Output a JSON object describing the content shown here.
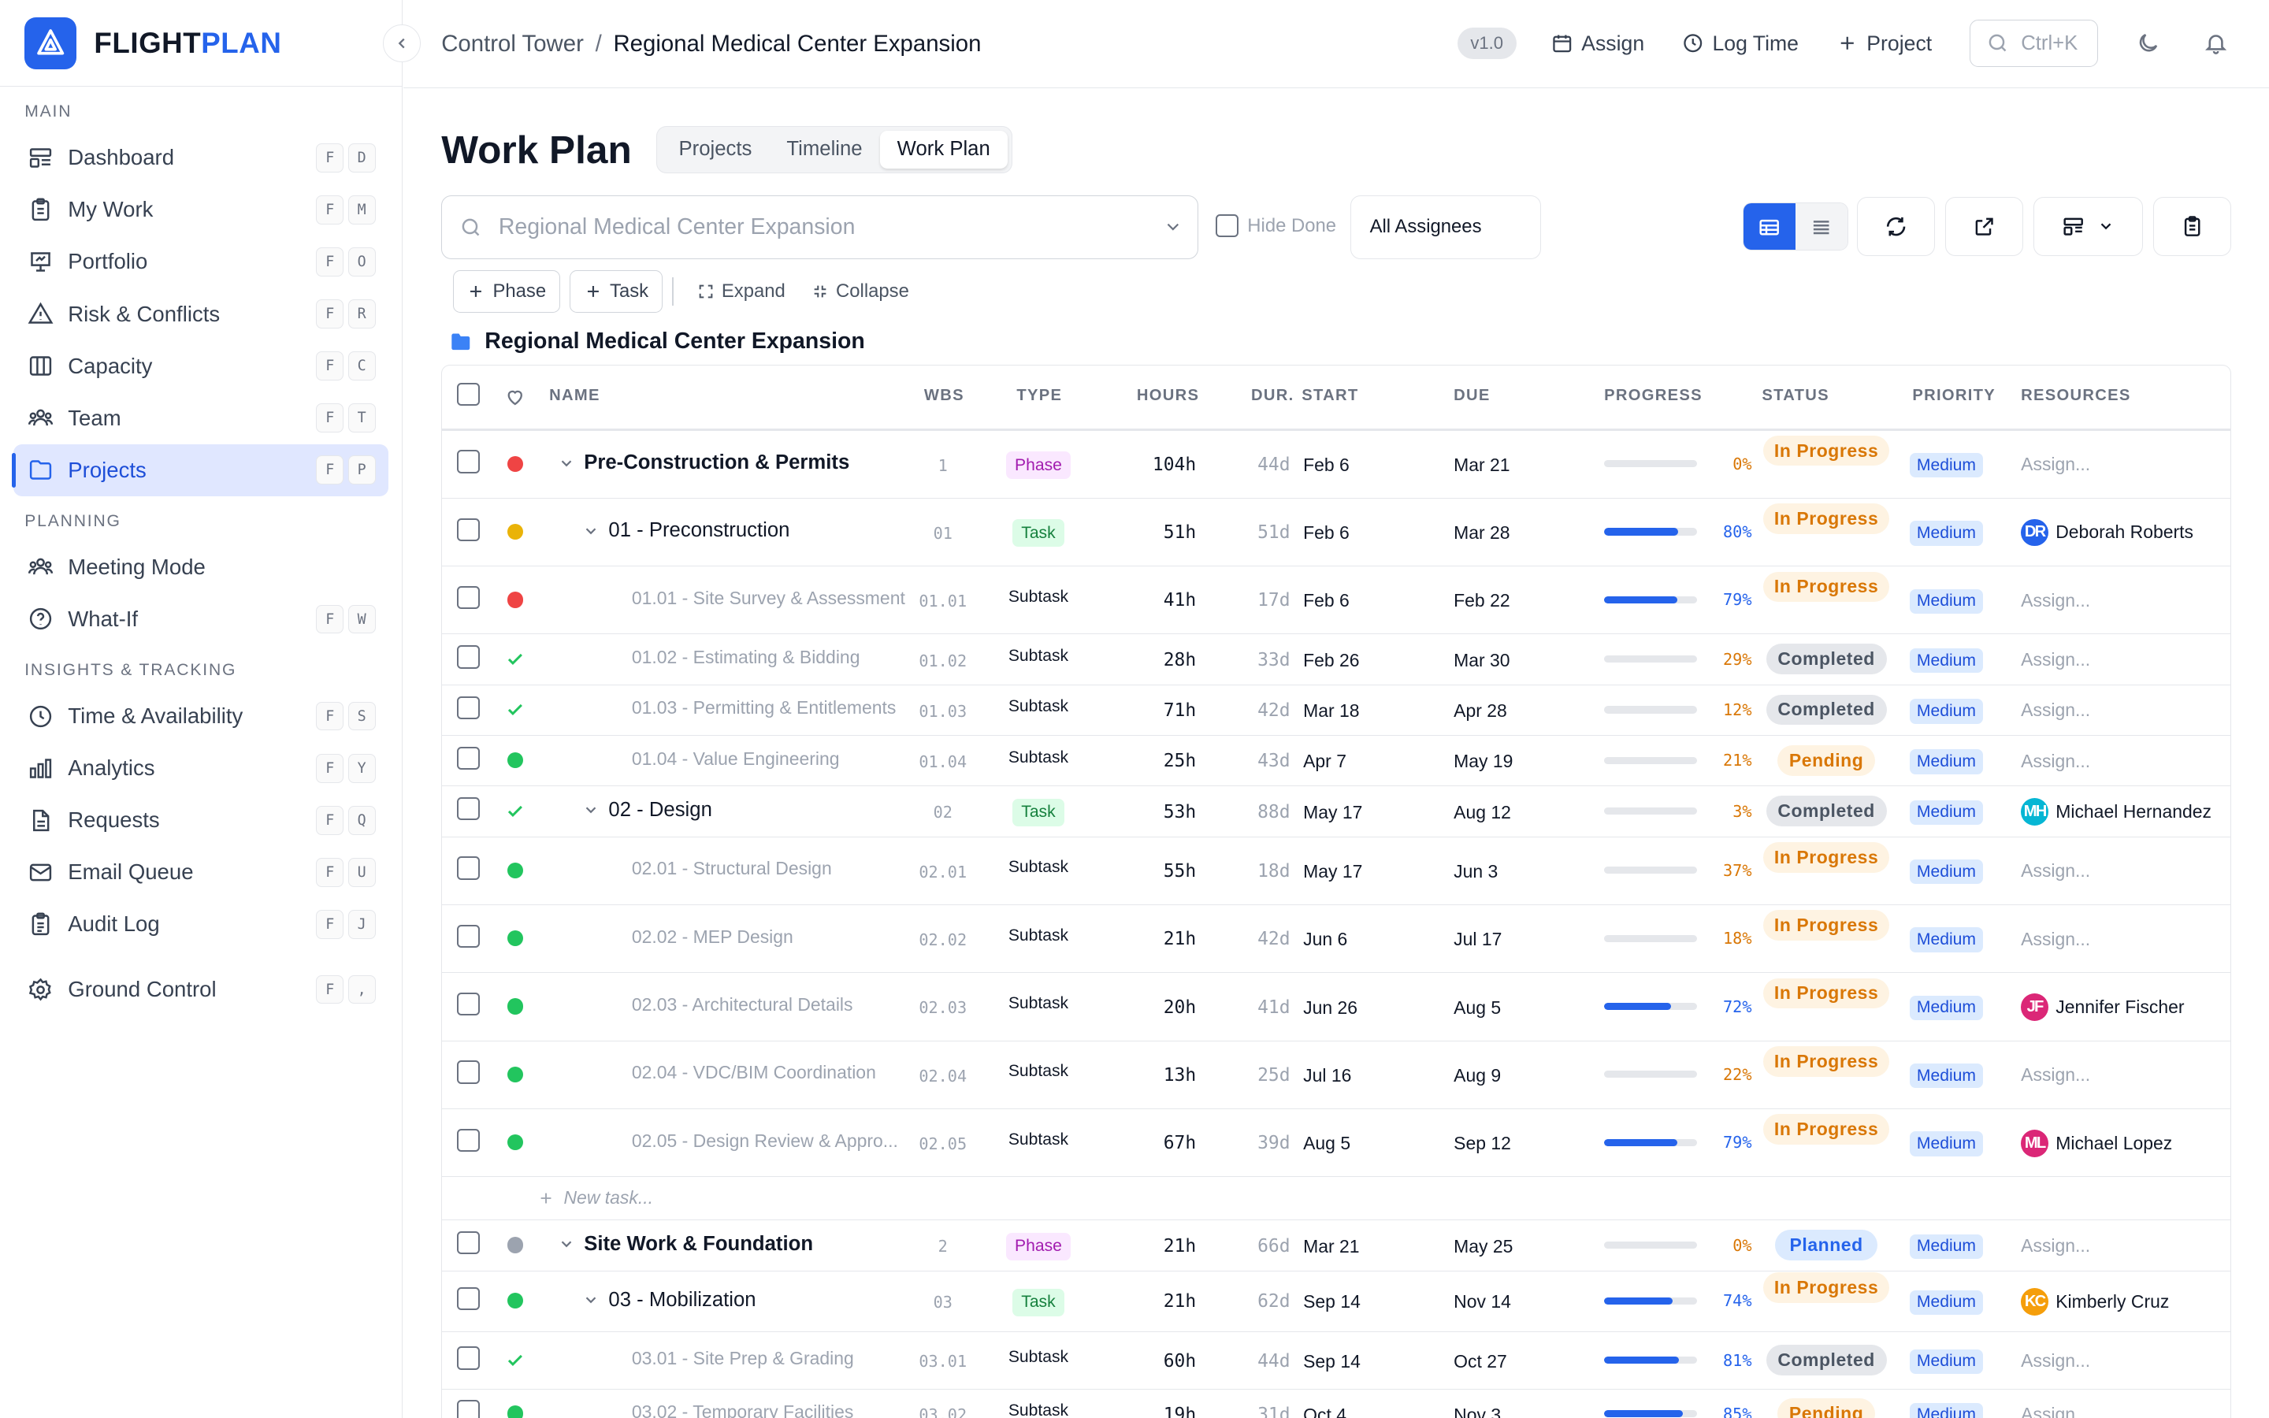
{
  "brand": {
    "part1": "FLIGHT",
    "part2": "PLAN"
  },
  "sidebar": {
    "sections": [
      {
        "title": "MAIN",
        "items": [
          {
            "label": "Dashboard",
            "icon": "dashboard-icon",
            "keys": [
              "F",
              "D"
            ]
          },
          {
            "label": "My Work",
            "icon": "clipboard-icon",
            "keys": [
              "F",
              "M"
            ]
          },
          {
            "label": "Portfolio",
            "icon": "presentation-icon",
            "keys": [
              "F",
              "O"
            ]
          },
          {
            "label": "Risk & Conflicts",
            "icon": "warning-icon",
            "keys": [
              "F",
              "R"
            ]
          },
          {
            "label": "Capacity",
            "icon": "columns-icon",
            "keys": [
              "F",
              "C"
            ]
          },
          {
            "label": "Team",
            "icon": "users-icon",
            "keys": [
              "F",
              "T"
            ]
          },
          {
            "label": "Projects",
            "icon": "folder-icon",
            "keys": [
              "F",
              "P"
            ],
            "active": true
          }
        ]
      },
      {
        "title": "PLANNING",
        "items": [
          {
            "label": "Meeting Mode",
            "icon": "users-icon",
            "keys": []
          },
          {
            "label": "What-If",
            "icon": "help-circle-icon",
            "keys": [
              "F",
              "W"
            ]
          }
        ]
      },
      {
        "title": "INSIGHTS & TRACKING",
        "items": [
          {
            "label": "Time & Availability",
            "icon": "clock-icon",
            "keys": [
              "F",
              "S"
            ]
          },
          {
            "label": "Analytics",
            "icon": "bar-chart-icon",
            "keys": [
              "F",
              "Y"
            ]
          },
          {
            "label": "Requests",
            "icon": "file-icon",
            "keys": [
              "F",
              "Q"
            ]
          },
          {
            "label": "Email Queue",
            "icon": "mail-icon",
            "keys": [
              "F",
              "U"
            ]
          },
          {
            "label": "Audit Log",
            "icon": "clipboard-list-icon",
            "keys": [
              "F",
              "J"
            ]
          }
        ]
      }
    ],
    "footer_item": {
      "label": "Ground Control",
      "icon": "gear-icon",
      "keys": [
        "F",
        ","
      ]
    }
  },
  "topbar": {
    "breadcrumb": [
      "Control Tower",
      "Regional Medical Center Expansion"
    ],
    "separator": "/",
    "version": "v1.0",
    "assign": "Assign",
    "log_time": "Log Time",
    "project": "Project",
    "search_shortcut": "Ctrl+K"
  },
  "main": {
    "title": "Work Plan",
    "tabs": [
      "Projects",
      "Timeline",
      "Work Plan"
    ],
    "active_tab": "Work Plan",
    "project_select": "Regional Medical Center Expansion",
    "hide_done": "Hide Done",
    "assignees": "All Assignees",
    "actions": {
      "phase": "Phase",
      "task": "Task",
      "expand": "Expand",
      "collapse": "Collapse"
    },
    "project_name": "Regional Medical Center Expansion",
    "new_task": "New task..."
  },
  "table": {
    "headers": {
      "name": "NAME",
      "wbs": "WBS",
      "type": "TYPE",
      "hours": "HOURS",
      "dur": "DUR.",
      "start": "START",
      "due": "DUE",
      "progress": "PROGRESS",
      "status": "STATUS",
      "priority": "PRIORITY",
      "resources": "RESOURCES"
    },
    "rows": [
      {
        "level": 0,
        "marker": "red",
        "name": "Pre-Construction & Permits",
        "wbs": "1",
        "type": "Phase",
        "hours": "104h",
        "dur": "44d",
        "start": "Feb 6",
        "due": "Mar 21",
        "progress": 0,
        "pct": "0%",
        "status": "In Progress",
        "priority": "Medium",
        "resource": "Assign...",
        "avatar": null
      },
      {
        "level": 1,
        "marker": "amber",
        "name": "01 - Preconstruction",
        "wbs": "01",
        "type": "Task",
        "hours": "51h",
        "dur": "51d",
        "start": "Feb 6",
        "due": "Mar 28",
        "progress": 80,
        "pct": "80%",
        "status": "In Progress",
        "priority": "Medium",
        "resource": "Deborah Roberts",
        "avatar": {
          "initials": "DR",
          "color": "#2563eb"
        }
      },
      {
        "level": 2,
        "marker": "red",
        "name": "01.01 - Site Survey & Assessment",
        "wbs": "01.01",
        "type": "Subtask",
        "hours": "41h",
        "dur": "17d",
        "start": "Feb 6",
        "due": "Feb 22",
        "progress": 79,
        "pct": "79%",
        "status": "In Progress",
        "priority": "Medium",
        "resource": "Assign...",
        "avatar": null
      },
      {
        "level": 2,
        "marker": "check",
        "name": "01.02 - Estimating & Bidding",
        "wbs": "01.02",
        "type": "Subtask",
        "hours": "28h",
        "dur": "33d",
        "start": "Feb 26",
        "due": "Mar 30",
        "progress": 29,
        "pct": "29%",
        "status": "Completed",
        "priority": "Medium",
        "resource": "Assign...",
        "avatar": null
      },
      {
        "level": 2,
        "marker": "check",
        "name": "01.03 - Permitting & Entitlements",
        "wbs": "01.03",
        "type": "Subtask",
        "hours": "71h",
        "dur": "42d",
        "start": "Mar 18",
        "due": "Apr 28",
        "progress": 12,
        "pct": "12%",
        "status": "Completed",
        "priority": "Medium",
        "resource": "Assign...",
        "avatar": null
      },
      {
        "level": 2,
        "marker": "green",
        "name": "01.04 - Value Engineering",
        "wbs": "01.04",
        "type": "Subtask",
        "hours": "25h",
        "dur": "43d",
        "start": "Apr 7",
        "due": "May 19",
        "progress": 21,
        "pct": "21%",
        "status": "Pending",
        "priority": "Medium",
        "resource": "Assign...",
        "avatar": null
      },
      {
        "level": 1,
        "marker": "check",
        "name": "02 - Design",
        "wbs": "02",
        "type": "Task",
        "hours": "53h",
        "dur": "88d",
        "start": "May 17",
        "due": "Aug 12",
        "progress": 3,
        "pct": "3%",
        "status": "Completed",
        "priority": "Medium",
        "resource": "Michael Hernandez",
        "avatar": {
          "initials": "MH",
          "color": "#06b6d4"
        }
      },
      {
        "level": 2,
        "marker": "green",
        "name": "02.01 - Structural Design",
        "wbs": "02.01",
        "type": "Subtask",
        "hours": "55h",
        "dur": "18d",
        "start": "May 17",
        "due": "Jun 3",
        "progress": 37,
        "pct": "37%",
        "status": "In Progress",
        "priority": "Medium",
        "resource": "Assign...",
        "avatar": null
      },
      {
        "level": 2,
        "marker": "green",
        "name": "02.02 - MEP Design",
        "wbs": "02.02",
        "type": "Subtask",
        "hours": "21h",
        "dur": "42d",
        "start": "Jun 6",
        "due": "Jul 17",
        "progress": 18,
        "pct": "18%",
        "status": "In Progress",
        "priority": "Medium",
        "resource": "Assign...",
        "avatar": null
      },
      {
        "level": 2,
        "marker": "green",
        "name": "02.03 - Architectural Details",
        "wbs": "02.03",
        "type": "Subtask",
        "hours": "20h",
        "dur": "41d",
        "start": "Jun 26",
        "due": "Aug 5",
        "progress": 72,
        "pct": "72%",
        "status": "In Progress",
        "priority": "Medium",
        "resource": "Jennifer Fischer",
        "avatar": {
          "initials": "JF",
          "color": "#db2777"
        }
      },
      {
        "level": 2,
        "marker": "green",
        "name": "02.04 - VDC/BIM Coordination",
        "wbs": "02.04",
        "type": "Subtask",
        "hours": "13h",
        "dur": "25d",
        "start": "Jul 16",
        "due": "Aug 9",
        "progress": 22,
        "pct": "22%",
        "status": "In Progress",
        "priority": "Medium",
        "resource": "Assign...",
        "avatar": null
      },
      {
        "level": 2,
        "marker": "green",
        "name": "02.05 - Design Review & Appro...",
        "wbs": "02.05",
        "type": "Subtask",
        "hours": "67h",
        "dur": "39d",
        "start": "Aug 5",
        "due": "Sep 12",
        "progress": 79,
        "pct": "79%",
        "status": "In Progress",
        "priority": "Medium",
        "resource": "Michael Lopez",
        "avatar": {
          "initials": "ML",
          "color": "#db2777"
        }
      },
      {
        "kind": "newtask"
      },
      {
        "level": 0,
        "marker": "gray",
        "name": "Site Work & Foundation",
        "wbs": "2",
        "type": "Phase",
        "hours": "21h",
        "dur": "66d",
        "start": "Mar 21",
        "due": "May 25",
        "progress": 0,
        "pct": "0%",
        "status": "Planned",
        "priority": "Medium",
        "resource": "Assign...",
        "avatar": null
      },
      {
        "level": 1,
        "marker": "green",
        "name": "03 - Mobilization",
        "wbs": "03",
        "type": "Task",
        "hours": "21h",
        "dur": "62d",
        "start": "Sep 14",
        "due": "Nov 14",
        "progress": 74,
        "pct": "74%",
        "status": "In Progress",
        "priority": "Medium",
        "resource": "Kimberly Cruz",
        "avatar": {
          "initials": "KC",
          "color": "#f59e0b"
        }
      },
      {
        "level": 2,
        "marker": "check",
        "name": "03.01 - Site Prep & Grading",
        "wbs": "03.01",
        "type": "Subtask",
        "hours": "60h",
        "dur": "44d",
        "start": "Sep 14",
        "due": "Oct 27",
        "progress": 81,
        "pct": "81%",
        "status": "Completed",
        "priority": "Medium",
        "resource": "Assign...",
        "avatar": null
      },
      {
        "level": 2,
        "marker": "green",
        "name": "03.02 - Temporary Facilities",
        "wbs": "03.02",
        "type": "Subtask",
        "hours": "19h",
        "dur": "31d",
        "start": "Oct 4",
        "due": "Nov 3",
        "progress": 85,
        "pct": "85%",
        "status": "Pending",
        "priority": "Medium",
        "resource": "Assign...",
        "avatar": null
      }
    ]
  },
  "colors": {
    "accent": "#2563eb",
    "red": "#ef4444",
    "amber": "#eab308",
    "green": "#22c55e",
    "gray": "#9ca3af"
  }
}
